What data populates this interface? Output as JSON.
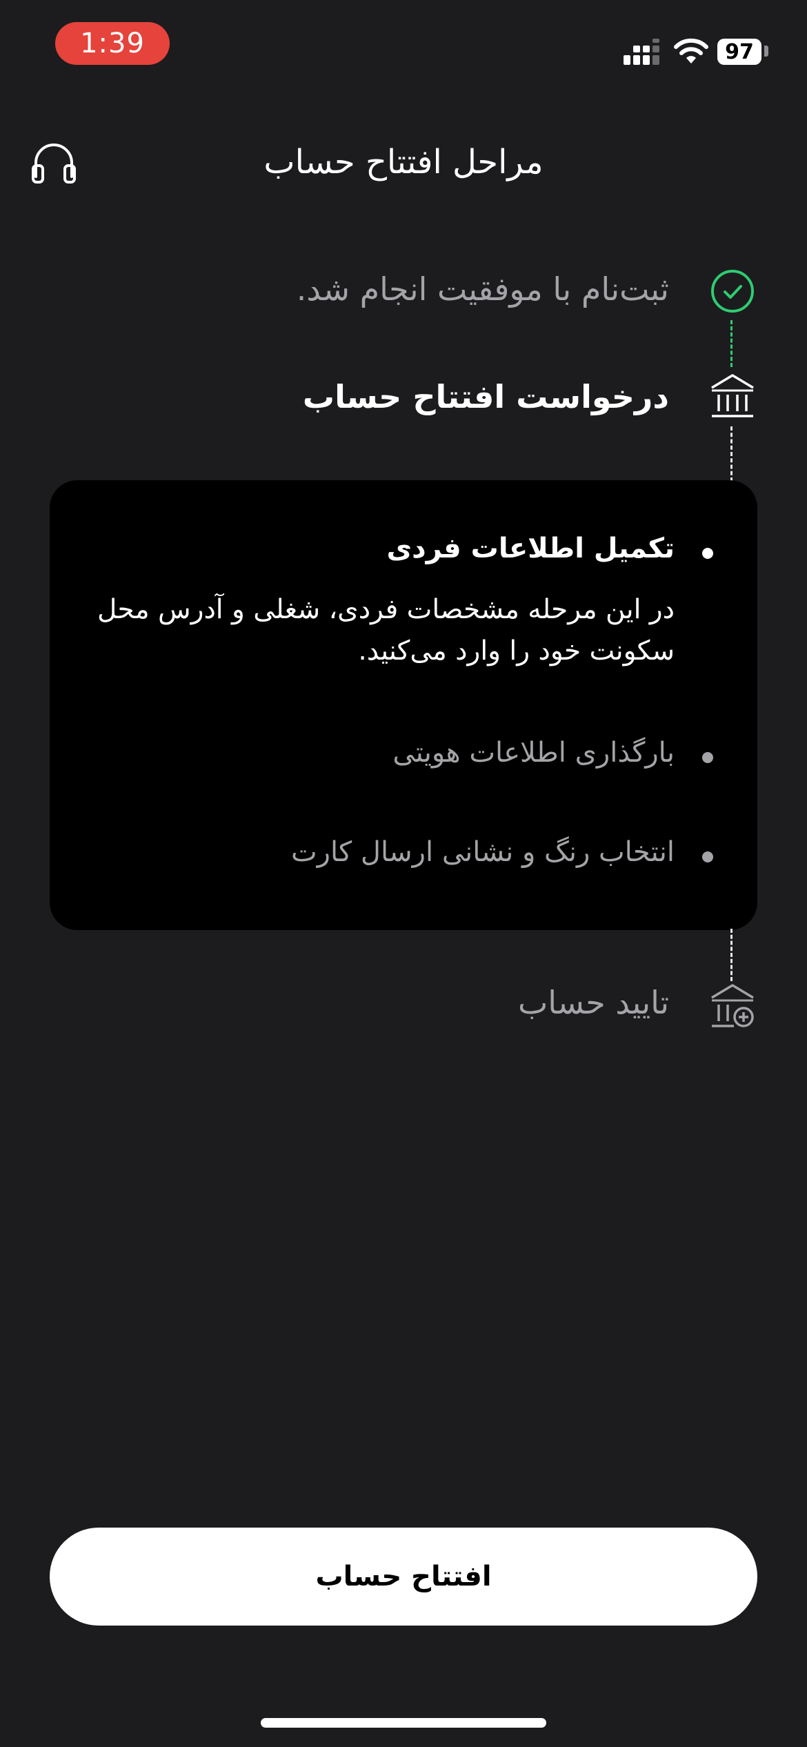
{
  "status_bar": {
    "time": "1:39",
    "battery": "97",
    "time_pill_color": "#e5433b"
  },
  "header": {
    "title": "مراحل افتتاح حساب",
    "support_icon": "headset-icon"
  },
  "steps": [
    {
      "label": "ثبت‌نام با موفقیت انجام شد.",
      "state": "done",
      "icon": "check-circle-icon"
    },
    {
      "label": "درخواست افتتاح حساب",
      "state": "current",
      "icon": "bank-icon"
    },
    {
      "label": "تایید حساب",
      "state": "pending",
      "icon": "bank-plus-icon"
    }
  ],
  "card": {
    "items": [
      {
        "title": "تکمیل اطلاعات فردی",
        "description_line1": "در این مرحله مشخصات فردی، شغلی و آدرس محل",
        "description_line2": "سکونت خود را وارد می‌کنید.",
        "active": true
      },
      {
        "title": "بارگذاری اطلاعات هویتی",
        "active": false
      },
      {
        "title": "انتخاب رنگ و نشانی ارسال کارت",
        "active": false
      }
    ]
  },
  "cta": {
    "label": "افتتاح حساب"
  },
  "colors": {
    "background": "#1c1c1e",
    "card": "#000000",
    "success": "#2ecc71",
    "muted_text": "#a4a4a8"
  }
}
